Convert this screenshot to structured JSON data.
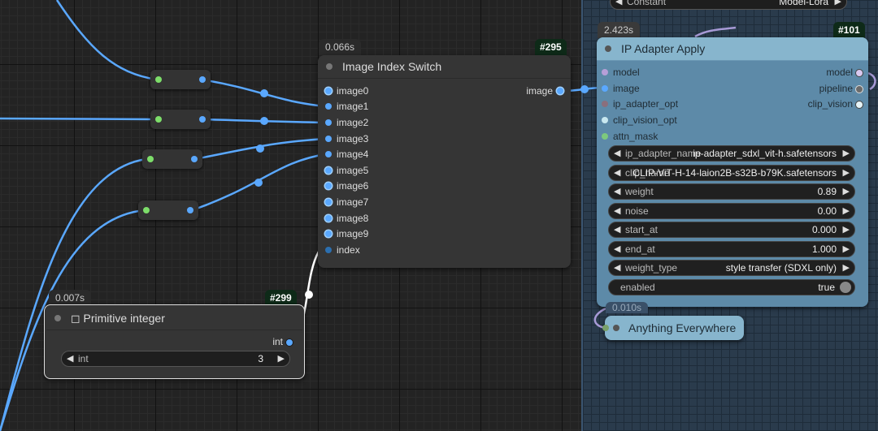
{
  "colors": {
    "canvas_bg": "#232323",
    "group_bg": "#2a3b4c",
    "wire_blue": "#5aa8ff",
    "wire_white": "#ffffff",
    "wire_purple": "#a79ad6",
    "node_bg": "#353535",
    "ip_node_bg": "#5d8aa8",
    "ip_node_title": "#87b5cd",
    "id_badge": "#0e2a18"
  },
  "top_widget": {
    "label": "Constant",
    "value": "Model-Lora"
  },
  "image_switch": {
    "time": "0.066s",
    "id": "#295",
    "title": "Image Index Switch",
    "inputs": [
      "image0",
      "image1",
      "image2",
      "image3",
      "image4",
      "image5",
      "image6",
      "image7",
      "image8",
      "image9",
      "index"
    ],
    "output": "image"
  },
  "primitive": {
    "time": "0.007s",
    "id": "#299",
    "title": "◻ Primitive integer",
    "output": "int",
    "widget_label": "int",
    "widget_value": "3"
  },
  "ip_adapter": {
    "time": "2.423s",
    "id": "#101",
    "title": "IP Adapter Apply",
    "inputs": [
      "model",
      "image",
      "ip_adapter_opt",
      "clip_vision_opt",
      "attn_mask"
    ],
    "outputs": [
      "model",
      "pipeline",
      "clip_vision"
    ],
    "widgets": [
      {
        "label": "ip_adapter_name",
        "value": "ip-adapter_sdxl_vit-h.safetensors"
      },
      {
        "label": "clip_name",
        "value": "CLIP-ViT-H-14-laion2B-s32B-b79K.safetensors"
      },
      {
        "label": "weight",
        "value": "0.89"
      },
      {
        "label": "noise",
        "value": "0.00"
      },
      {
        "label": "start_at",
        "value": "0.000"
      },
      {
        "label": "end_at",
        "value": "1.000"
      },
      {
        "label": "weight_type",
        "value": "style transfer (SDXL only)"
      }
    ],
    "toggle": {
      "label": "enabled",
      "value": "true"
    }
  },
  "anything_everywhere": {
    "time": "0.010s",
    "title": "Anything Everywhere"
  }
}
